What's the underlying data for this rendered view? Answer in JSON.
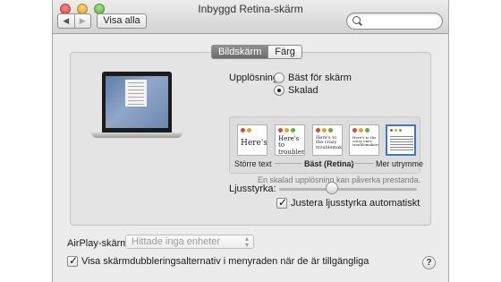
{
  "window": {
    "title": "Inbyggd Retina-skärm",
    "nav_back": "◀",
    "nav_forward": "▶",
    "show_all_label": "Visa alla",
    "search_placeholder": ""
  },
  "tabs": [
    {
      "label": "Bildskärm",
      "active": true
    },
    {
      "label": "Färg",
      "active": false
    }
  ],
  "resolution": {
    "label": "Upplösning:",
    "options": [
      {
        "label": "Bäst för skärm",
        "selected": false
      },
      {
        "label": "Skalad",
        "selected": true
      }
    ]
  },
  "scaling": {
    "thumbnails": [
      {
        "text": "Here's",
        "selected": false
      },
      {
        "text": "Here's to troublem",
        "selected": false
      },
      {
        "text": "Here's to the crazy troublemakers",
        "selected": false
      },
      {
        "text": "Here's to the crazy ones troublemakers",
        "selected": false
      },
      {
        "text": "",
        "selected": true
      }
    ],
    "labels": {
      "left": "Större text",
      "middle": "Bäst (Retina)",
      "right": "Mer utrymme"
    },
    "note": "En skalad upplösning kan påverka prestanda."
  },
  "brightness": {
    "label": "Ljusstyrka:",
    "level_fraction": 0.38,
    "auto_label": "Justera ljusstyrka automatiskt",
    "auto_checked": true
  },
  "airplay": {
    "label": "AirPlay-skärm:",
    "selected_value": "Hittade inga enheter"
  },
  "mirroring": {
    "label": "Visa skärmdubbleringsalternativ i menyraden när de är tillgängliga",
    "checked": true
  },
  "help_label": "?",
  "colors": {
    "traffic_red": "#e2463b",
    "traffic_yellow": "#e0a527",
    "traffic_green": "#58b23a",
    "selection_blue": "#3a78d4"
  }
}
